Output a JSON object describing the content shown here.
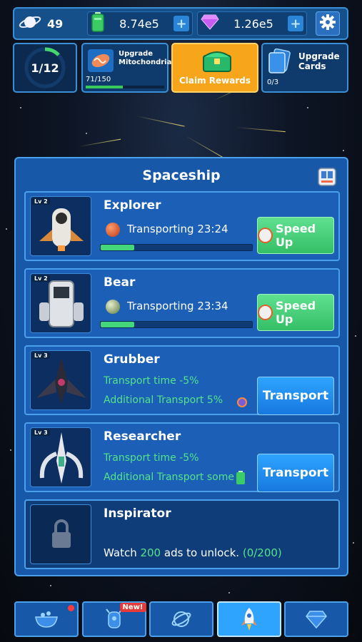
{
  "resources": {
    "planets": "49",
    "energy": "8.74e5",
    "gems": "1.26e5"
  },
  "quests": {
    "progress": "1/12",
    "mitochondria_title": "Upgrade Mitochondria",
    "mitochondria_count": "71/150",
    "mitochondria_fraction": 0.473,
    "claim_label": "Claim Rewards",
    "cards_title": "Upgrade Cards",
    "cards_count": "0/3"
  },
  "panel": {
    "title": "Spaceship"
  },
  "ships": [
    {
      "name": "Explorer",
      "level": "Lv 2",
      "status": "Transporting 23:24",
      "progress": 0.22,
      "button": "Speed Up"
    },
    {
      "name": "Bear",
      "level": "Lv 2",
      "status": "Transporting 23:34",
      "progress": 0.22,
      "button": "Speed Up"
    },
    {
      "name": "Grubber",
      "level": "Lv 3",
      "line1": "Transport time -5%",
      "line2": "Additional Transport 5%",
      "button": "Transport"
    },
    {
      "name": "Researcher",
      "level": "Lv 3",
      "line1": "Transport time -5%",
      "line2": "Additional Transport some",
      "button": "Transport"
    }
  ],
  "locked_ship": {
    "name": "Inspirator",
    "unlock_prefix": "Watch ",
    "unlock_count": "200",
    "unlock_suffix": " ads to unlock. ",
    "unlock_progress": "(0/200)"
  },
  "nav": {
    "new_badge": "New!",
    "active_tab": "spaceship"
  },
  "colors": {
    "accent_green": "#55e38a",
    "panel_blue": "#1758a8",
    "button_blue": "#2ea4ff",
    "claim_orange": "#f7a51b"
  }
}
